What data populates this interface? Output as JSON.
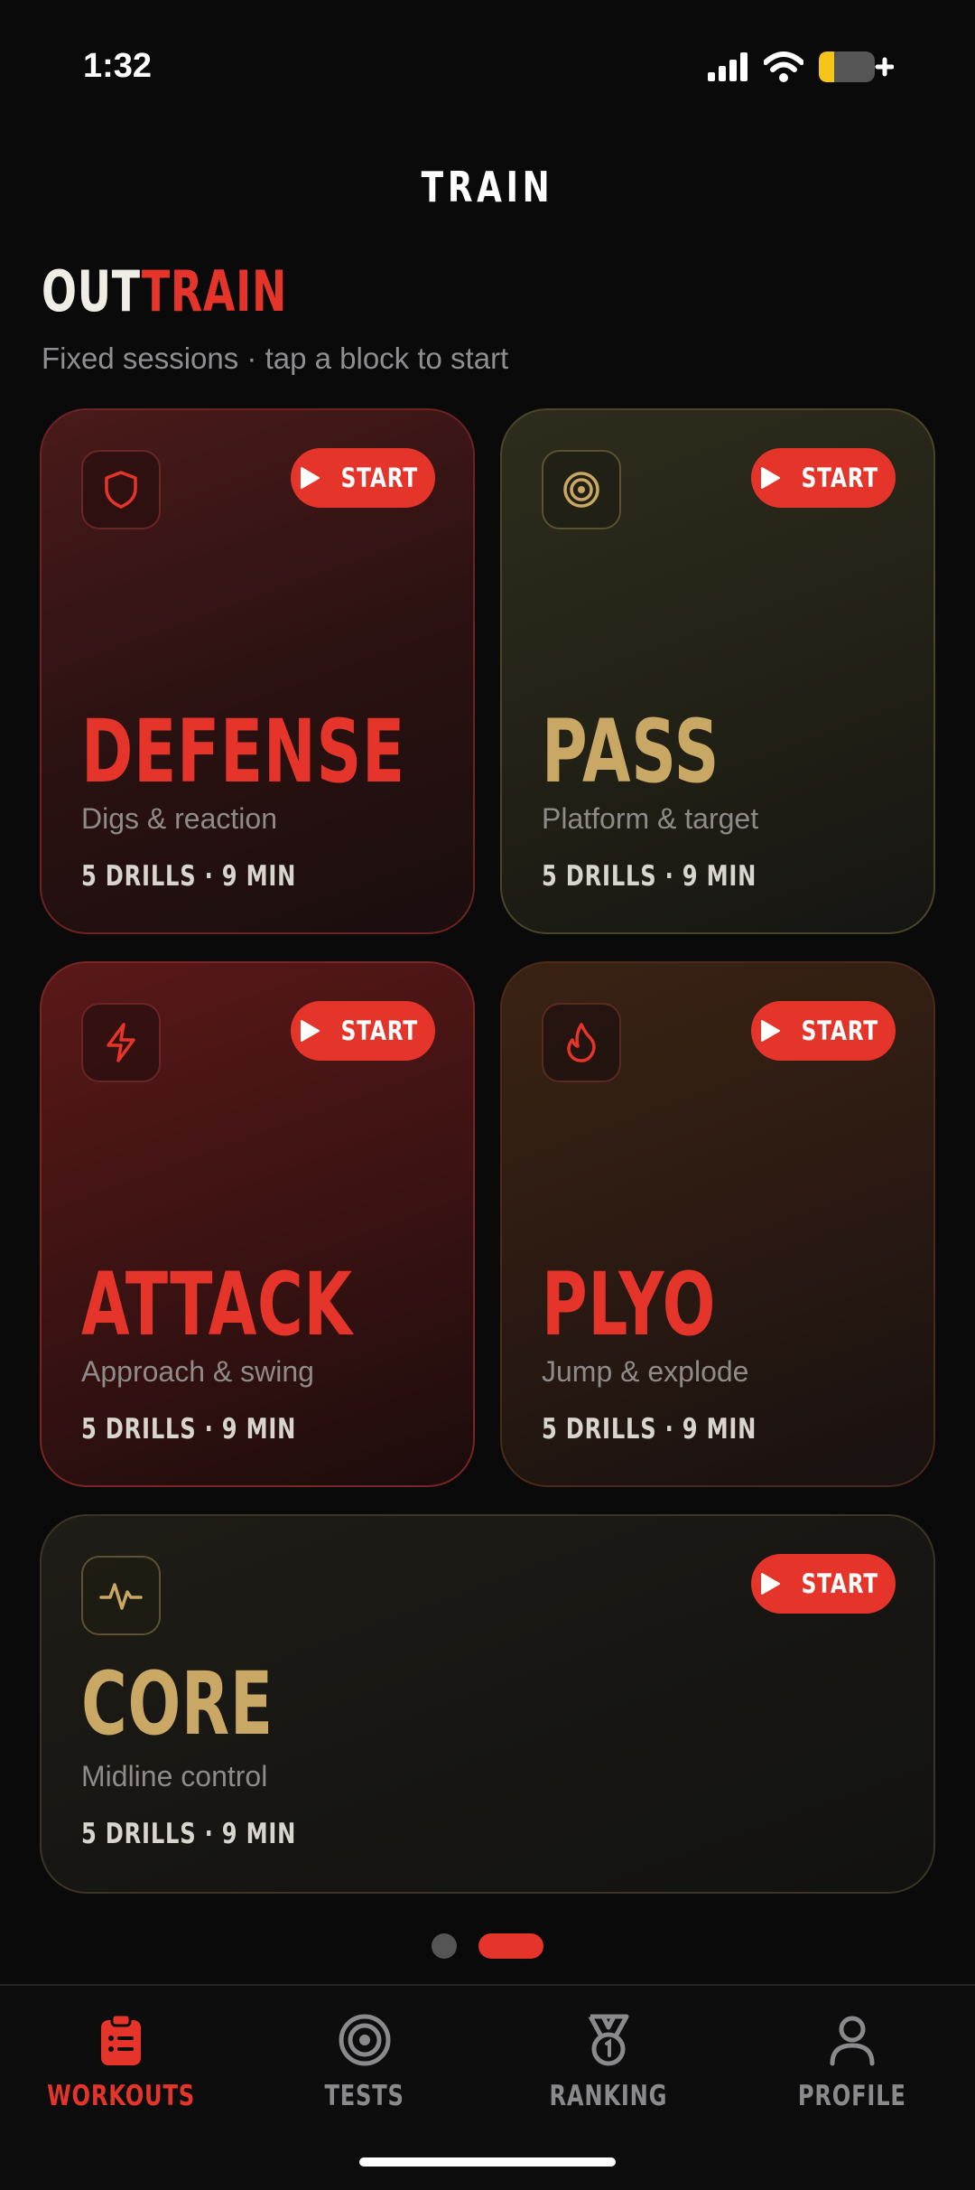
{
  "status_bar": {
    "time": "1:32"
  },
  "header": {
    "title": "TRAIN"
  },
  "brand": {
    "part1": "OUT",
    "part2": "TRAIN"
  },
  "subtitle": "Fixed sessions · tap a block to start",
  "start_label": "START",
  "cards": [
    {
      "title": "DEFENSE",
      "description": "Digs & reaction",
      "meta": "5 DRILLS · 9 MIN",
      "icon": "shield-icon"
    },
    {
      "title": "PASS",
      "description": "Platform & target",
      "meta": "5 DRILLS · 9 MIN",
      "icon": "target-icon"
    },
    {
      "title": "ATTACK",
      "description": "Approach & swing",
      "meta": "5 DRILLS · 9 MIN",
      "icon": "lightning-icon"
    },
    {
      "title": "PLYO",
      "description": "Jump & explode",
      "meta": "5 DRILLS · 9 MIN",
      "icon": "flame-icon"
    },
    {
      "title": "CORE",
      "description": "Midline control",
      "meta": "5 DRILLS · 9 MIN",
      "icon": "pulse-icon"
    }
  ],
  "pager": {
    "pages": 2,
    "active": 2
  },
  "tabs": [
    {
      "label": "WORKOUTS",
      "icon": "clipboard-icon",
      "active": true
    },
    {
      "label": "TESTS",
      "icon": "target-icon",
      "active": false
    },
    {
      "label": "RANKING",
      "icon": "medal-icon",
      "active": false
    },
    {
      "label": "PROFILE",
      "icon": "person-icon",
      "active": false
    }
  ],
  "colors": {
    "accent": "#e5352b",
    "gold": "#c9a765",
    "background": "#0a0a0b"
  }
}
